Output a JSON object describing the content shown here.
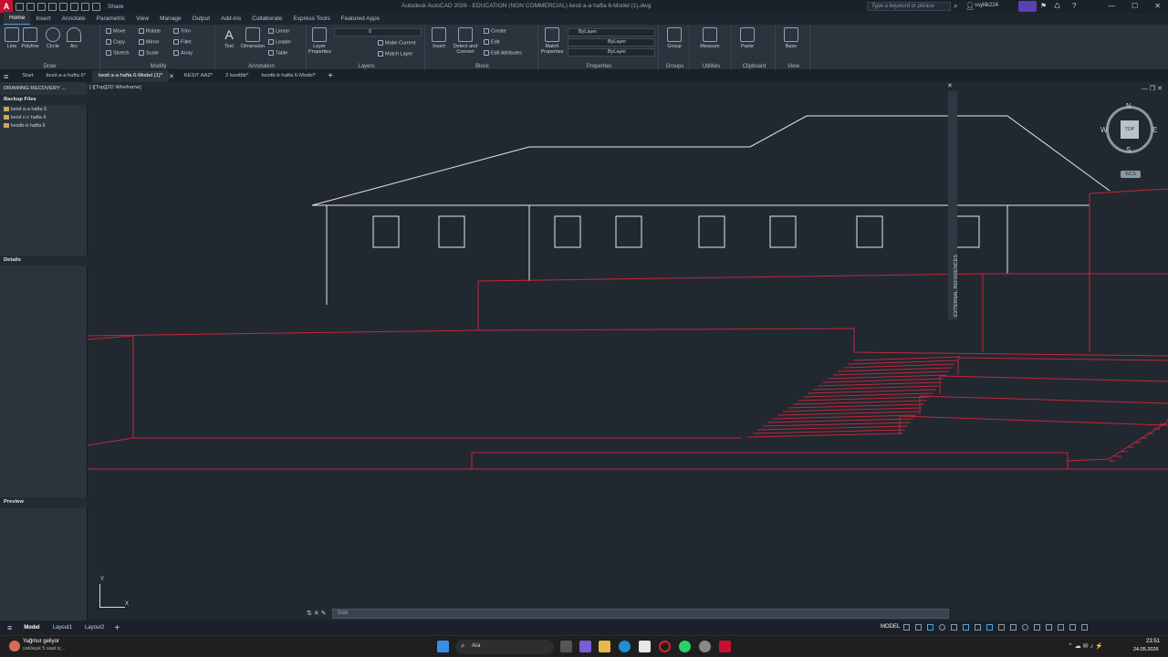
{
  "app": {
    "logo_letter": "A",
    "window_title": "Autodesk AutoCAD 2026 - EDUCATION (NON COMMERCIAL) kesit a-a hafta 6-Model (1).dwg",
    "share_label": "Share",
    "search_placeholder": "Type a keyword or phrase",
    "user_name": "ssyilik224",
    "window_buttons": [
      "—",
      "☐",
      "✕"
    ]
  },
  "ribbon_tabs": [
    "Home",
    "Insert",
    "Annotate",
    "Parametric",
    "View",
    "Manage",
    "Output",
    "Add-ins",
    "Collaborate",
    "Express Tools",
    "Featured Apps"
  ],
  "ribbon": {
    "draw": {
      "title": "Draw",
      "tools": [
        "Line",
        "Polyline",
        "Circle",
        "Arc"
      ]
    },
    "modify": {
      "title": "Modify",
      "tools": [
        "Move",
        "Rotate",
        "Trim",
        "Copy",
        "Mirror",
        "Fillet",
        "Stretch",
        "Scale",
        "Array"
      ]
    },
    "annotation": {
      "title": "Annotation",
      "tools": [
        "Text",
        "Dimension",
        "Linear",
        "Leader",
        "Table"
      ]
    },
    "layers": {
      "title": "Layers",
      "tools": [
        "Layer Properties",
        "Make Current",
        "Match Layer"
      ],
      "current_layer": "0"
    },
    "block": {
      "title": "Block",
      "tools": [
        "Insert",
        "Detect and Convert",
        "Create",
        "Edit",
        "Edit Attributes"
      ]
    },
    "properties": {
      "title": "Properties",
      "match_label": "Match Properties",
      "color": "ByLayer",
      "linetype": "ByLayer",
      "lineweight": "ByLayer"
    },
    "groups": {
      "title": "Groups",
      "tool": "Group"
    },
    "utilities": {
      "title": "Utilities",
      "tool": "Measure"
    },
    "clipboard": {
      "title": "Clipboard",
      "tool": "Paste"
    },
    "view": {
      "title": "View",
      "tool": "Base"
    }
  },
  "doc_tabs": [
    "Start",
    "kesit a-a hafta 6*",
    "kesit a-a hafta 6-Model (1)*",
    "KESIT AA2*",
    "2 kesitbb*",
    "kesitb-b hafta 6-Model*"
  ],
  "left_panel": {
    "title": "DRAWING RECOVERY ...",
    "backup_header": "Backup Files",
    "files": [
      "kesit a-a hafta 6",
      "kesit c-c hafta 6",
      "kesitb-b hafta 6"
    ],
    "details_header": "Details",
    "preview_header": "Preview"
  },
  "viewport": {
    "view_label": "[-][Top][2D Wireframe]",
    "xref_label": "EXTERNAL REFERENCES",
    "compass": {
      "n": "N",
      "s": "S",
      "e": "E",
      "w": "W",
      "top": "TOP",
      "wcs": "WCS"
    },
    "ucs_y": "Y",
    "ucs_x": "X"
  },
  "command_line": {
    "placeholder": "Ddd"
  },
  "status": {
    "layout_tabs": [
      "Model",
      "Layout1",
      "Layout2"
    ],
    "model_label": "MODEL"
  },
  "taskbar": {
    "notification_title": "Yağmur geliyor",
    "notification_sub": "yaklaşık 5 saat iç...",
    "search_label": "Ara",
    "time": "23:51",
    "date": "24.05.2026"
  },
  "colors": {
    "background": "#212830",
    "white_line": "#e6e9ec",
    "red_line": "#c4263a",
    "accent": "#4aa3df"
  }
}
